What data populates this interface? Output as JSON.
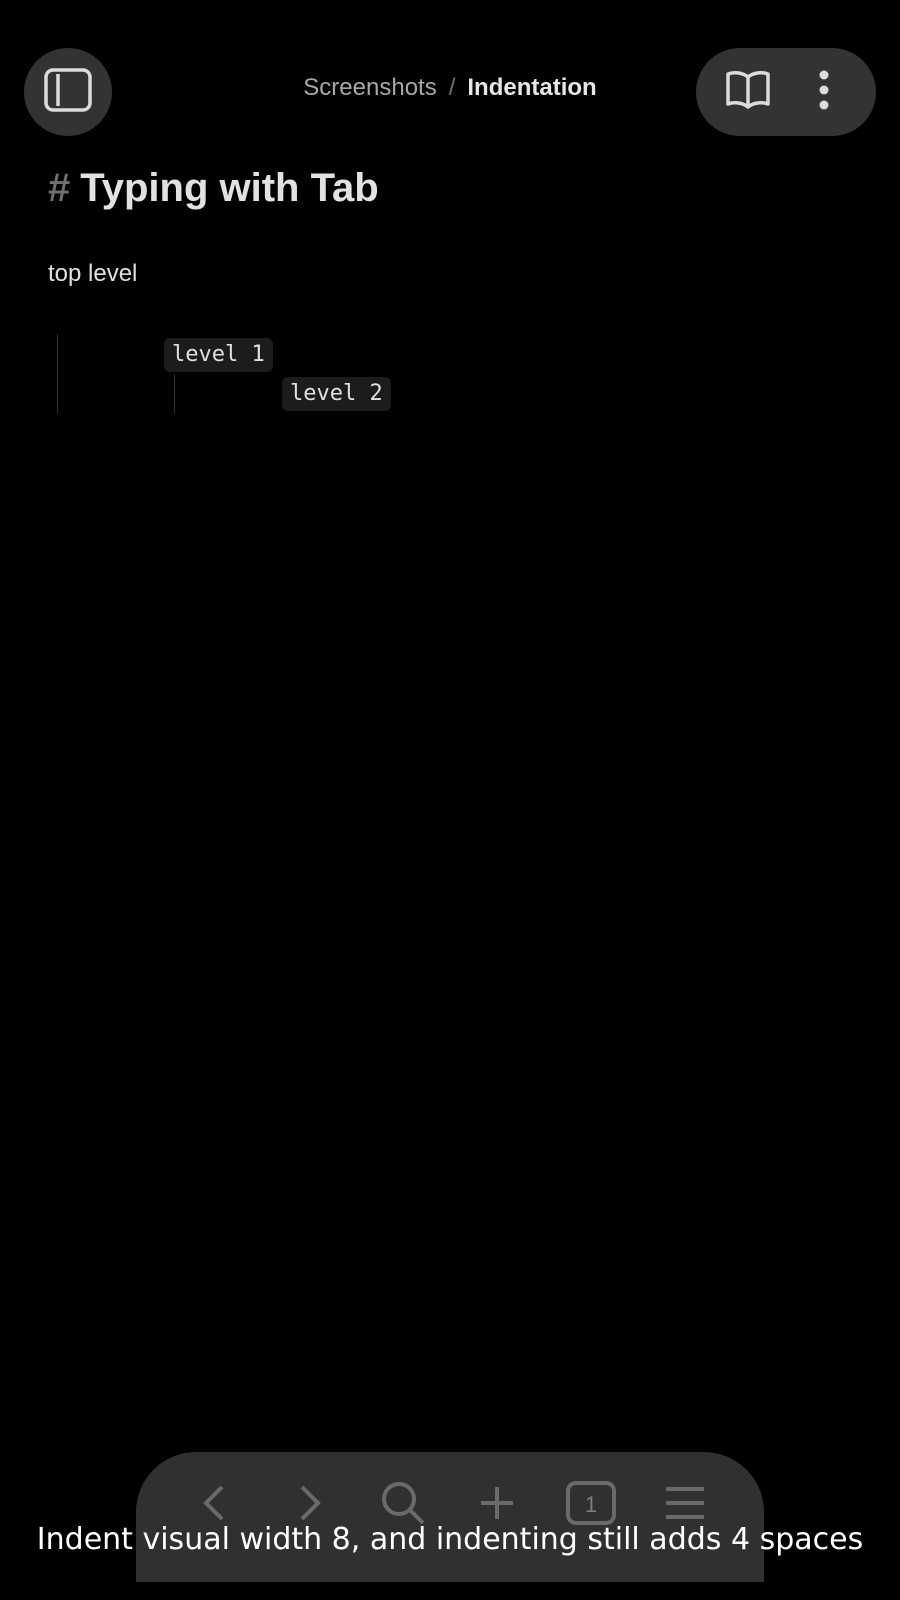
{
  "breadcrumb": {
    "parent": "Screenshots",
    "separator": "/",
    "current": "Indentation"
  },
  "document": {
    "heading_marker": "#",
    "heading": "Typing with Tab",
    "paragraph": "top level",
    "code_lines": [
      {
        "text": "level 1",
        "indent_level": 1
      },
      {
        "text": "level 2",
        "indent_level": 2
      }
    ]
  },
  "toolbar": {
    "icons": [
      "back-icon",
      "forward-icon",
      "search-icon",
      "plus-icon",
      "tab-count-icon",
      "menu-icon"
    ],
    "tab_count": "1"
  },
  "caption": "Indent visual width 8, and indenting still adds 4 spaces"
}
